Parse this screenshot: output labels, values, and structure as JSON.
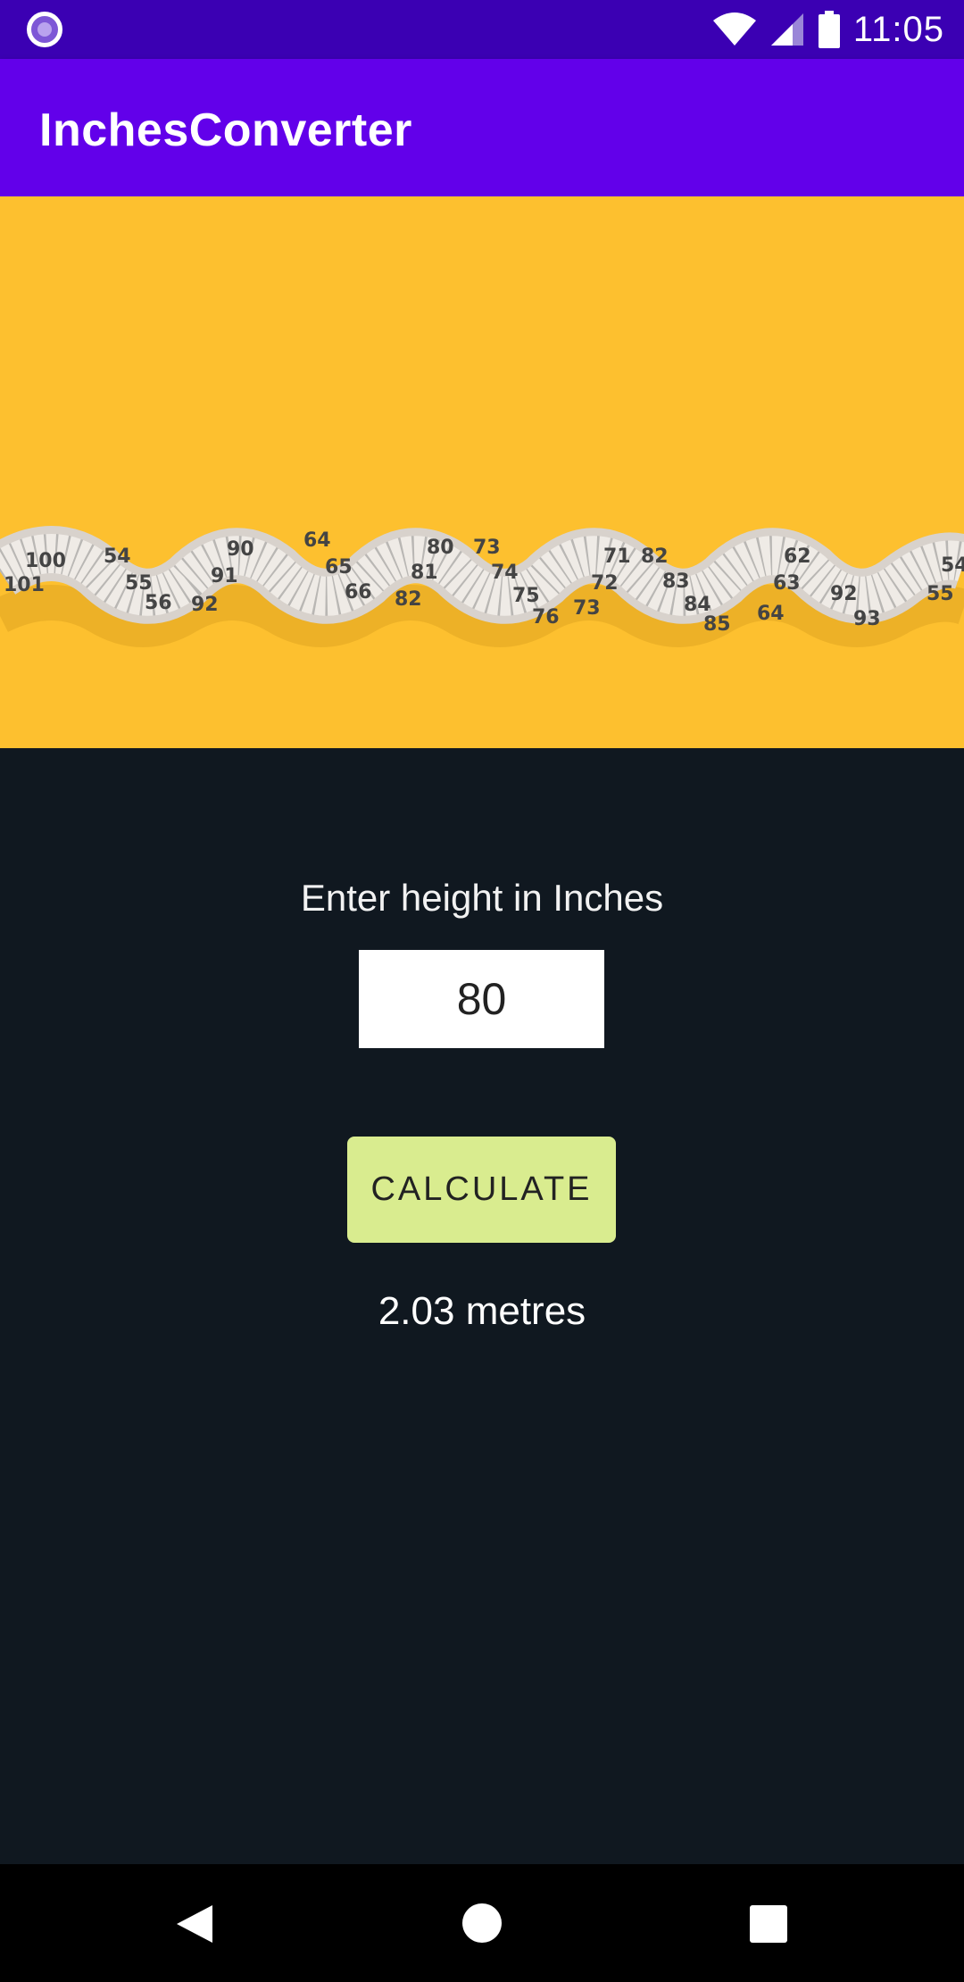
{
  "status_bar": {
    "time": "11:05",
    "left_icon": "notification-circle-icon",
    "icons": [
      "wifi-icon",
      "signal-icon",
      "battery-icon"
    ]
  },
  "app_bar": {
    "title": "InchesConverter"
  },
  "hero": {
    "image": "tape-measure-photo",
    "tape_numbers": [
      "100",
      "101",
      "54",
      "55",
      "56",
      "90",
      "91",
      "92",
      "64",
      "65",
      "66",
      "80",
      "81",
      "82",
      "73",
      "74",
      "75",
      "76",
      "71",
      "72",
      "73",
      "82",
      "83",
      "84",
      "85",
      "62",
      "63",
      "64",
      "92",
      "93",
      "54",
      "55"
    ]
  },
  "form": {
    "prompt_label": "Enter height in Inches",
    "input_value": "80",
    "calculate_label": "CALCULATE",
    "result": "2.03 metres"
  },
  "nav_bar": {
    "icons": [
      "back-icon",
      "home-icon",
      "recents-icon"
    ]
  },
  "colors": {
    "status_bar": "#3b00b3",
    "app_bar": "#6200ea",
    "hero_background": "#fdc02f",
    "content_background": "#101820",
    "button": "#d9ec8f"
  }
}
